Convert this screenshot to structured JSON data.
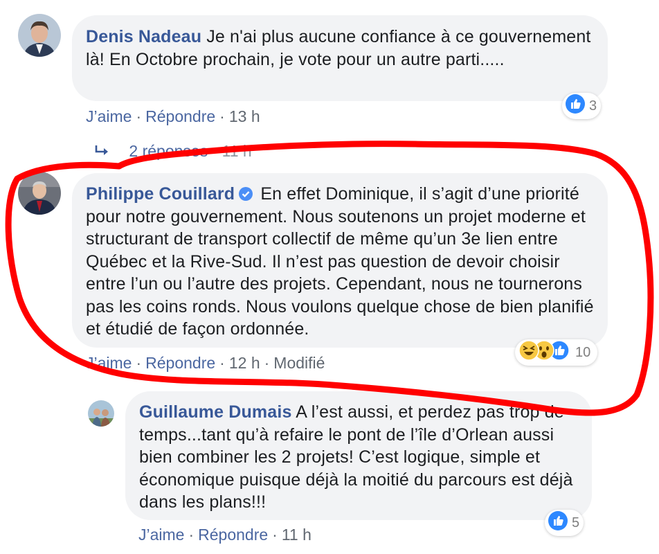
{
  "comments": [
    {
      "author": "Denis Nadeau",
      "text": "Je n'ai plus aucune confiance à ce gouvernement là! En Octobre prochain, je vote pour un autre parti.....",
      "like_label": "J’aime",
      "reply_label": "Répondre",
      "time": "13 h",
      "reaction_count": "3"
    },
    {
      "author": "Philippe Couillard",
      "verified": true,
      "text": "En effet Dominique, il s’agit d’une priorité pour notre gouvernement. Nous soutenons un projet moderne et structurant de transport collectif de même qu’un 3e lien entre Québec et la Rive-Sud. Il n’est pas question de devoir choisir entre l’un ou l’autre des projets. Cependant, nous ne tournerons pas les coins ronds. Nous voulons quelque chose de bien planifié et étudié de façon ordonnée.",
      "like_label": "J’aime",
      "reply_label": "Répondre",
      "time": "12 h",
      "edited_label": "Modifié",
      "reaction_count": "10"
    },
    {
      "author": "Guillaume Dumais",
      "text": "A l’est aussi, et perdez pas trop de temps...tant qu’à refaire le pont de l’île d’Orlean aussi bien combiner les 2 projets! C’est logique, simple et économique puisque déjà la moitié du parcours est déjà dans les plans!!!",
      "like_label": "J’aime",
      "reply_label": "Répondre",
      "time": "11 h",
      "reaction_count": "5"
    }
  ],
  "replies_link": {
    "label": "2 réponses",
    "time": "11 h"
  },
  "colors": {
    "link": "#385898",
    "bubble": "#f2f3f5",
    "annotation": "#ff0000"
  },
  "icons": [
    "like-reaction-icon",
    "haha-reaction-icon",
    "wow-reaction-icon",
    "verified-badge-icon",
    "reply-arrow-icon"
  ]
}
